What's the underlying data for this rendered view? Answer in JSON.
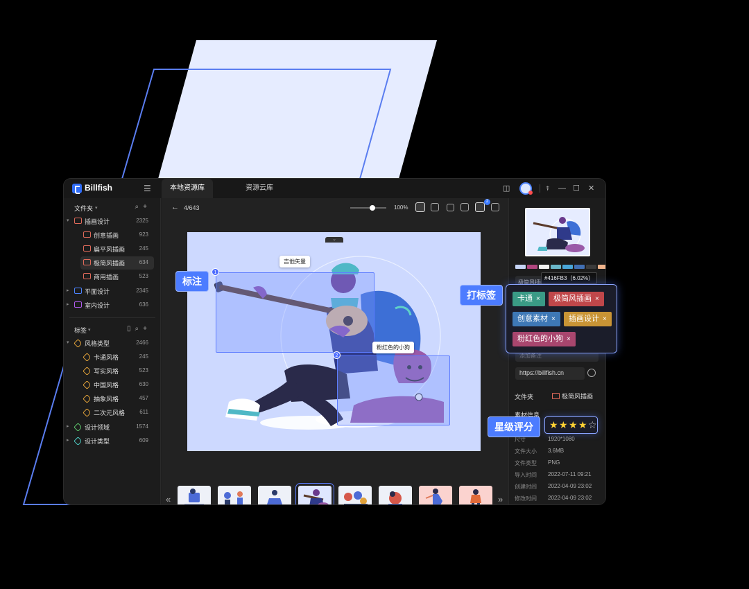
{
  "app": {
    "name": "Billfish",
    "tabs": [
      "本地资源库",
      "资源云库"
    ]
  },
  "colors": {
    "accent": "#4c7cff",
    "folder_icon": "#e06a5a",
    "tag_icon": "#e0a13a",
    "canvas_bg": "#cdd9ff"
  },
  "sidebar": {
    "folders_title": "文件夹",
    "folders": [
      {
        "label": "插画设计",
        "count": "2325"
      },
      {
        "label": "创意插画",
        "count": "923"
      },
      {
        "label": "扁平风插画",
        "count": "245"
      },
      {
        "label": "极简风插画",
        "count": "634"
      },
      {
        "label": "商用插画",
        "count": "523"
      },
      {
        "label": "平面设计",
        "count": "2345"
      },
      {
        "label": "室内设计",
        "count": "636"
      }
    ],
    "tags_title": "标签",
    "tags": [
      {
        "label": "风格类型",
        "count": "2466"
      },
      {
        "label": "卡通风格",
        "count": "245"
      },
      {
        "label": "写实风格",
        "count": "523"
      },
      {
        "label": "中国风格",
        "count": "630"
      },
      {
        "label": "抽象风格",
        "count": "457"
      },
      {
        "label": "二次元风格",
        "count": "611"
      },
      {
        "label": "设计领域",
        "count": "1574"
      },
      {
        "label": "设计类型",
        "count": "609"
      }
    ]
  },
  "viewer": {
    "page": "4/643",
    "zoom": "100%",
    "annotation_count": "2",
    "annotations": [
      {
        "num": "1",
        "text": "吉他矢量"
      },
      {
        "num": "2",
        "text": "粉红色的小狗"
      }
    ],
    "thumbnail_count": 8,
    "selected_thumbnail": 4
  },
  "inspector": {
    "palette": [
      "#c6d4f5",
      "#b0467f",
      "#f2f2f2",
      "#6ab7c8",
      "#49a6d8",
      "#416fb3",
      "#3b3b3b",
      "#f0b48c"
    ],
    "color_tip": "#416FB3（6.02%）",
    "title_value": "极简风插画",
    "note_placeholder": "添加备注",
    "url": "https://billfish.cn",
    "folder_label": "文件夹",
    "folder_value": "极简风插画",
    "meta_title": "素材信息",
    "rating": 4,
    "meta": [
      {
        "key": "尺寸",
        "value": "1920*1080"
      },
      {
        "key": "文件大小",
        "value": "3.6MB"
      },
      {
        "key": "文件类型",
        "value": "PNG"
      },
      {
        "key": "导入时间",
        "value": "2022-07-11 09:21"
      },
      {
        "key": "创建时间",
        "value": "2022-04-09 23:02"
      },
      {
        "key": "修改时间",
        "value": "2022-04-09 23:02"
      }
    ]
  },
  "callouts": {
    "annotate": "标注",
    "tagging": "打标签",
    "rating": "星级评分"
  },
  "tag_chips": [
    {
      "label": "卡通",
      "color": "#3a9a86"
    },
    {
      "label": "极简风插画",
      "color": "#c0474a"
    },
    {
      "label": "创意素材",
      "color": "#3e78b6"
    },
    {
      "label": "插画设计",
      "color": "#c99435"
    },
    {
      "label": "粉红色的小狗",
      "color": "#a8466e"
    }
  ],
  "glyphs": {
    "close": "×",
    "star_on": "★",
    "star_off": "☆",
    "caret": "▾"
  }
}
